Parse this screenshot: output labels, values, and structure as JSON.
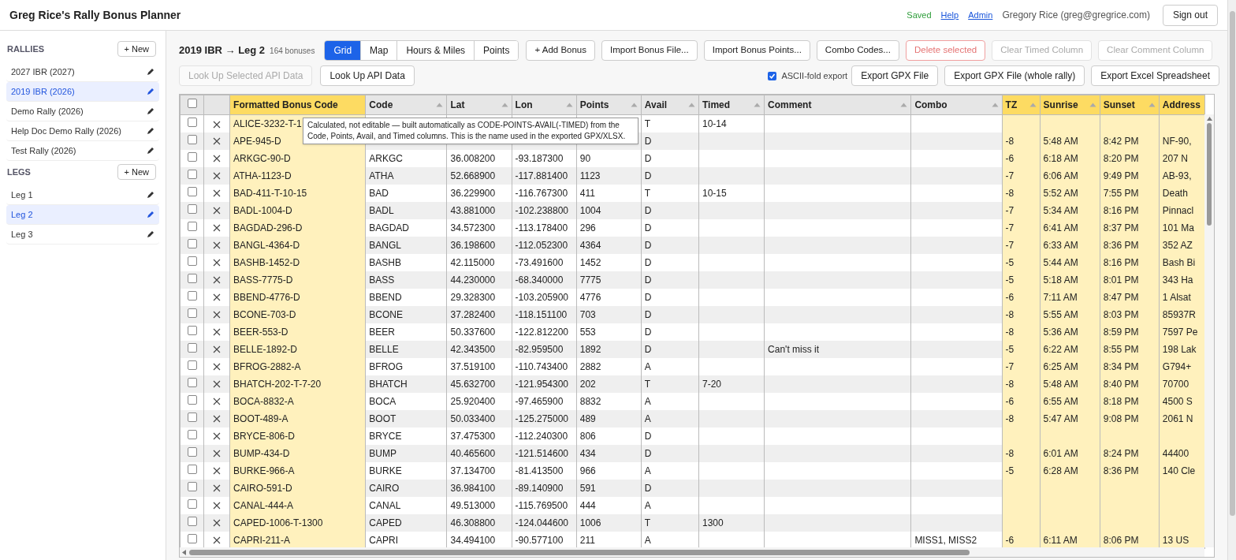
{
  "app_title": "Greg Rice's Rally Bonus Planner",
  "header": {
    "save_status": "Saved",
    "links": [
      "Help",
      "Admin"
    ],
    "user": "Gregory Rice (greg@gregrice.com)",
    "sign_out": "Sign out"
  },
  "sidebar": {
    "sections": [
      {
        "heading": "RALLIES",
        "new_button": "+ New",
        "items": [
          {
            "label": "2027 IBR (2027)",
            "selected": false
          },
          {
            "label": "2019 IBR (2026)",
            "selected": true
          },
          {
            "label": "Demo Rally (2026)",
            "selected": false
          },
          {
            "label": "Help Doc Demo Rally (2026)",
            "selected": false
          },
          {
            "label": "Test Rally (2026)",
            "selected": false
          }
        ]
      },
      {
        "heading": "LEGS",
        "new_button": "+ New",
        "items": [
          {
            "label": "Leg 1",
            "selected": false
          },
          {
            "label": "Leg 2",
            "selected": true
          },
          {
            "label": "Leg 3",
            "selected": false
          }
        ]
      }
    ]
  },
  "page_title": "2019 IBR → Leg 2",
  "bonus_count": "164 bonuses",
  "view_tabs": [
    {
      "label": "Grid",
      "selected": true
    },
    {
      "label": "Map",
      "selected": false
    },
    {
      "label": "Hours & Miles",
      "selected": false
    },
    {
      "label": "Points",
      "selected": false
    }
  ],
  "toolbar_buttons": [
    {
      "label": "+ Add Bonus",
      "kind": "normal",
      "disabled": false
    },
    {
      "label": "Import Bonus File...",
      "kind": "normal",
      "disabled": false
    },
    {
      "label": "Import Bonus Points...",
      "kind": "normal",
      "disabled": false
    },
    {
      "label": "Combo Codes...",
      "kind": "normal",
      "disabled": false
    },
    {
      "label": "Delete selected",
      "kind": "danger",
      "disabled": true
    },
    {
      "label": "Clear Timed Column",
      "kind": "normal",
      "disabled": true
    },
    {
      "label": "Clear Comment Column",
      "kind": "normal",
      "disabled": true
    }
  ],
  "lookup_buttons": [
    {
      "label": "Look Up Selected API Data",
      "disabled": true
    },
    {
      "label": "Look Up API Data",
      "disabled": false
    }
  ],
  "ascii_fold": {
    "label": "ASCII-fold export",
    "checked": true
  },
  "export_buttons": [
    "Export GPX File",
    "Export GPX File (whole rally)",
    "Export Excel Spreadsheet"
  ],
  "table": {
    "select_all": {
      "checked": false
    },
    "columns": [
      {
        "label": "Formatted Bonus Code",
        "highlighted": true,
        "sortable": false
      },
      {
        "label": "Code",
        "highlighted": false,
        "sortable": true
      },
      {
        "label": "Lat",
        "highlighted": false,
        "sortable": true
      },
      {
        "label": "Lon",
        "highlighted": false,
        "sortable": true
      },
      {
        "label": "Points",
        "highlighted": false,
        "sortable": true
      },
      {
        "label": "Avail",
        "highlighted": false,
        "sortable": true
      },
      {
        "label": "Timed",
        "highlighted": false,
        "sortable": true
      },
      {
        "label": "Comment",
        "highlighted": false,
        "sortable": true
      },
      {
        "label": "Combo",
        "highlighted": false,
        "sortable": true
      },
      {
        "label": "TZ",
        "highlighted": true,
        "sortable": true
      },
      {
        "label": "Sunrise",
        "highlighted": true,
        "sortable": true
      },
      {
        "label": "Sunset",
        "highlighted": true,
        "sortable": true
      },
      {
        "label": "Address",
        "highlighted": true,
        "sortable": false
      }
    ],
    "rows": [
      {
        "checked": false,
        "cells": [
          "ALICE-3232-T-1",
          null,
          null,
          null,
          null,
          "T",
          "10-14",
          null,
          null,
          null,
          null,
          null,
          null
        ]
      },
      {
        "checked": false,
        "cells": [
          "APE-945-D",
          null,
          null,
          null,
          null,
          "D",
          null,
          null,
          null,
          "-8",
          "5:48 AM",
          "8:42 PM",
          "NF-90,"
        ]
      },
      {
        "checked": false,
        "cells": [
          "ARKGC-90-D",
          "ARKGC",
          "36.008200",
          "-93.187300",
          "90",
          "D",
          null,
          null,
          null,
          "-6",
          "6:18 AM",
          "8:20 PM",
          "207 N"
        ]
      },
      {
        "checked": false,
        "cells": [
          "ATHA-1123-D",
          "ATHA",
          "52.668900",
          "-117.881400",
          "1123",
          "D",
          null,
          null,
          null,
          "-7",
          "6:06 AM",
          "9:49 PM",
          "AB-93,"
        ]
      },
      {
        "checked": false,
        "cells": [
          "BAD-411-T-10-15",
          "BAD",
          "36.229900",
          "-116.767300",
          "411",
          "T",
          "10-15",
          null,
          null,
          "-8",
          "5:52 AM",
          "7:55 PM",
          "Death"
        ]
      },
      {
        "checked": false,
        "cells": [
          "BADL-1004-D",
          "BADL",
          "43.881000",
          "-102.238800",
          "1004",
          "D",
          null,
          null,
          null,
          "-7",
          "5:34 AM",
          "8:16 PM",
          "Pinnacl"
        ]
      },
      {
        "checked": false,
        "cells": [
          "BAGDAD-296-D",
          "BAGDAD",
          "34.572300",
          "-113.178400",
          "296",
          "D",
          null,
          null,
          null,
          "-7",
          "6:41 AM",
          "8:37 PM",
          "101 Ma"
        ]
      },
      {
        "checked": false,
        "cells": [
          "BANGL-4364-D",
          "BANGL",
          "36.198600",
          "-112.052300",
          "4364",
          "D",
          null,
          null,
          null,
          "-7",
          "6:33 AM",
          "8:36 PM",
          "352 AZ"
        ]
      },
      {
        "checked": false,
        "cells": [
          "BASHB-1452-D",
          "BASHB",
          "42.115000",
          "-73.491600",
          "1452",
          "D",
          null,
          null,
          null,
          "-5",
          "5:44 AM",
          "8:16 PM",
          "Bash Bi"
        ]
      },
      {
        "checked": false,
        "cells": [
          "BASS-7775-D",
          "BASS",
          "44.230000",
          "-68.340000",
          "7775",
          "D",
          null,
          null,
          null,
          "-5",
          "5:18 AM",
          "8:01 PM",
          "343 Ha"
        ]
      },
      {
        "checked": false,
        "cells": [
          "BBEND-4776-D",
          "BBEND",
          "29.328300",
          "-103.205900",
          "4776",
          "D",
          null,
          null,
          null,
          "-6",
          "7:11 AM",
          "8:47 PM",
          "1 Alsat"
        ]
      },
      {
        "checked": false,
        "cells": [
          "BCONE-703-D",
          "BCONE",
          "37.282400",
          "-118.151100",
          "703",
          "D",
          null,
          null,
          null,
          "-8",
          "5:55 AM",
          "8:03 PM",
          "85937R"
        ]
      },
      {
        "checked": false,
        "cells": [
          "BEER-553-D",
          "BEER",
          "50.337600",
          "-122.812200",
          "553",
          "D",
          null,
          null,
          null,
          "-8",
          "5:36 AM",
          "8:59 PM",
          "7597 Pe"
        ]
      },
      {
        "checked": false,
        "cells": [
          "BELLE-1892-D",
          "BELLE",
          "42.343500",
          "-82.959500",
          "1892",
          "D",
          null,
          "Can't miss it",
          null,
          "-5",
          "6:22 AM",
          "8:55 PM",
          "198 Lak"
        ]
      },
      {
        "checked": false,
        "cells": [
          "BFROG-2882-A",
          "BFROG",
          "37.519100",
          "-110.743400",
          "2882",
          "A",
          null,
          null,
          null,
          "-7",
          "6:25 AM",
          "8:34 PM",
          "G794+"
        ]
      },
      {
        "checked": false,
        "cells": [
          "BHATCH-202-T-7-20",
          "BHATCH",
          "45.632700",
          "-121.954300",
          "202",
          "T",
          "7-20",
          null,
          null,
          "-8",
          "5:48 AM",
          "8:40 PM",
          "70700"
        ]
      },
      {
        "checked": false,
        "cells": [
          "BOCA-8832-A",
          "BOCA",
          "25.920400",
          "-97.465900",
          "8832",
          "A",
          null,
          null,
          null,
          "-6",
          "6:55 AM",
          "8:18 PM",
          "4500 S"
        ]
      },
      {
        "checked": false,
        "cells": [
          "BOOT-489-A",
          "BOOT",
          "50.033400",
          "-125.275000",
          "489",
          "A",
          null,
          null,
          null,
          "-8",
          "5:47 AM",
          "9:08 PM",
          "2061 N"
        ]
      },
      {
        "checked": false,
        "cells": [
          "BRYCE-806-D",
          "BRYCE",
          "37.475300",
          "-112.240300",
          "806",
          "D",
          null,
          null,
          null,
          null,
          null,
          null,
          null
        ]
      },
      {
        "checked": false,
        "cells": [
          "BUMP-434-D",
          "BUMP",
          "40.465600",
          "-121.514600",
          "434",
          "D",
          null,
          null,
          null,
          "-8",
          "6:01 AM",
          "8:24 PM",
          "44400"
        ]
      },
      {
        "checked": false,
        "cells": [
          "BURKE-966-A",
          "BURKE",
          "37.134700",
          "-81.413500",
          "966",
          "A",
          null,
          null,
          null,
          "-5",
          "6:28 AM",
          "8:36 PM",
          "140 Cle"
        ]
      },
      {
        "checked": false,
        "cells": [
          "CAIRO-591-D",
          "CAIRO",
          "36.984100",
          "-89.140900",
          "591",
          "D",
          null,
          null,
          null,
          null,
          null,
          null,
          null
        ]
      },
      {
        "checked": false,
        "cells": [
          "CANAL-444-A",
          "CANAL",
          "49.513000",
          "-115.769500",
          "444",
          "A",
          null,
          null,
          null,
          null,
          null,
          null,
          null
        ]
      },
      {
        "checked": false,
        "cells": [
          "CAPED-1006-T-1300",
          "CAPED",
          "46.308800",
          "-124.044600",
          "1006",
          "T",
          "1300",
          null,
          null,
          null,
          null,
          null,
          null
        ]
      },
      {
        "checked": false,
        "cells": [
          "CAPRI-211-A",
          "CAPRI",
          "34.494100",
          "-90.577100",
          "211",
          "A",
          null,
          null,
          "MISS1, MISS2",
          "-6",
          "6:11 AM",
          "8:06 PM",
          "13 US"
        ]
      }
    ]
  },
  "tooltip": "Calculated, not editable — built automatically as CODE-POINTS-AVAIL(-TIMED) from the Code, Points, Avail, and Timed columns. This is the name used in the exported GPX/XLSX."
}
